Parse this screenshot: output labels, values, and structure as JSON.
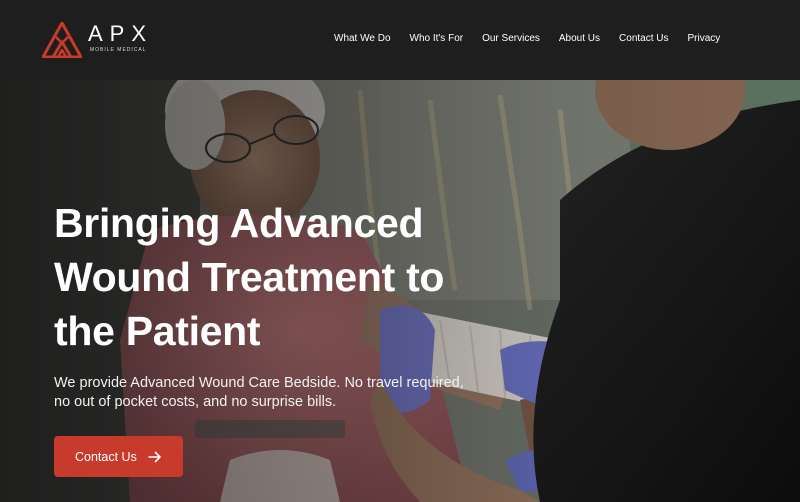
{
  "brand": {
    "name": "APX",
    "tagline": "MOBILE MEDICAL",
    "logo_icon": "apx-mountain-logo",
    "accent_color": "#c83a2b"
  },
  "nav": {
    "items": [
      {
        "label": "What We Do"
      },
      {
        "label": "Who It's For"
      },
      {
        "label": "Our Services"
      },
      {
        "label": "About Us"
      },
      {
        "label": "Contact Us"
      },
      {
        "label": "Privacy"
      }
    ]
  },
  "hero": {
    "title": "Bringing Advanced Wound Treatment to the Patient",
    "subtitle": "We provide Advanced Wound Care Bedside. No travel required, no out of pocket costs, and no surprise bills.",
    "cta_label": "Contact Us",
    "cta_icon": "arrow-right-icon",
    "image": "clinician bandaging the arm of an older woman"
  }
}
